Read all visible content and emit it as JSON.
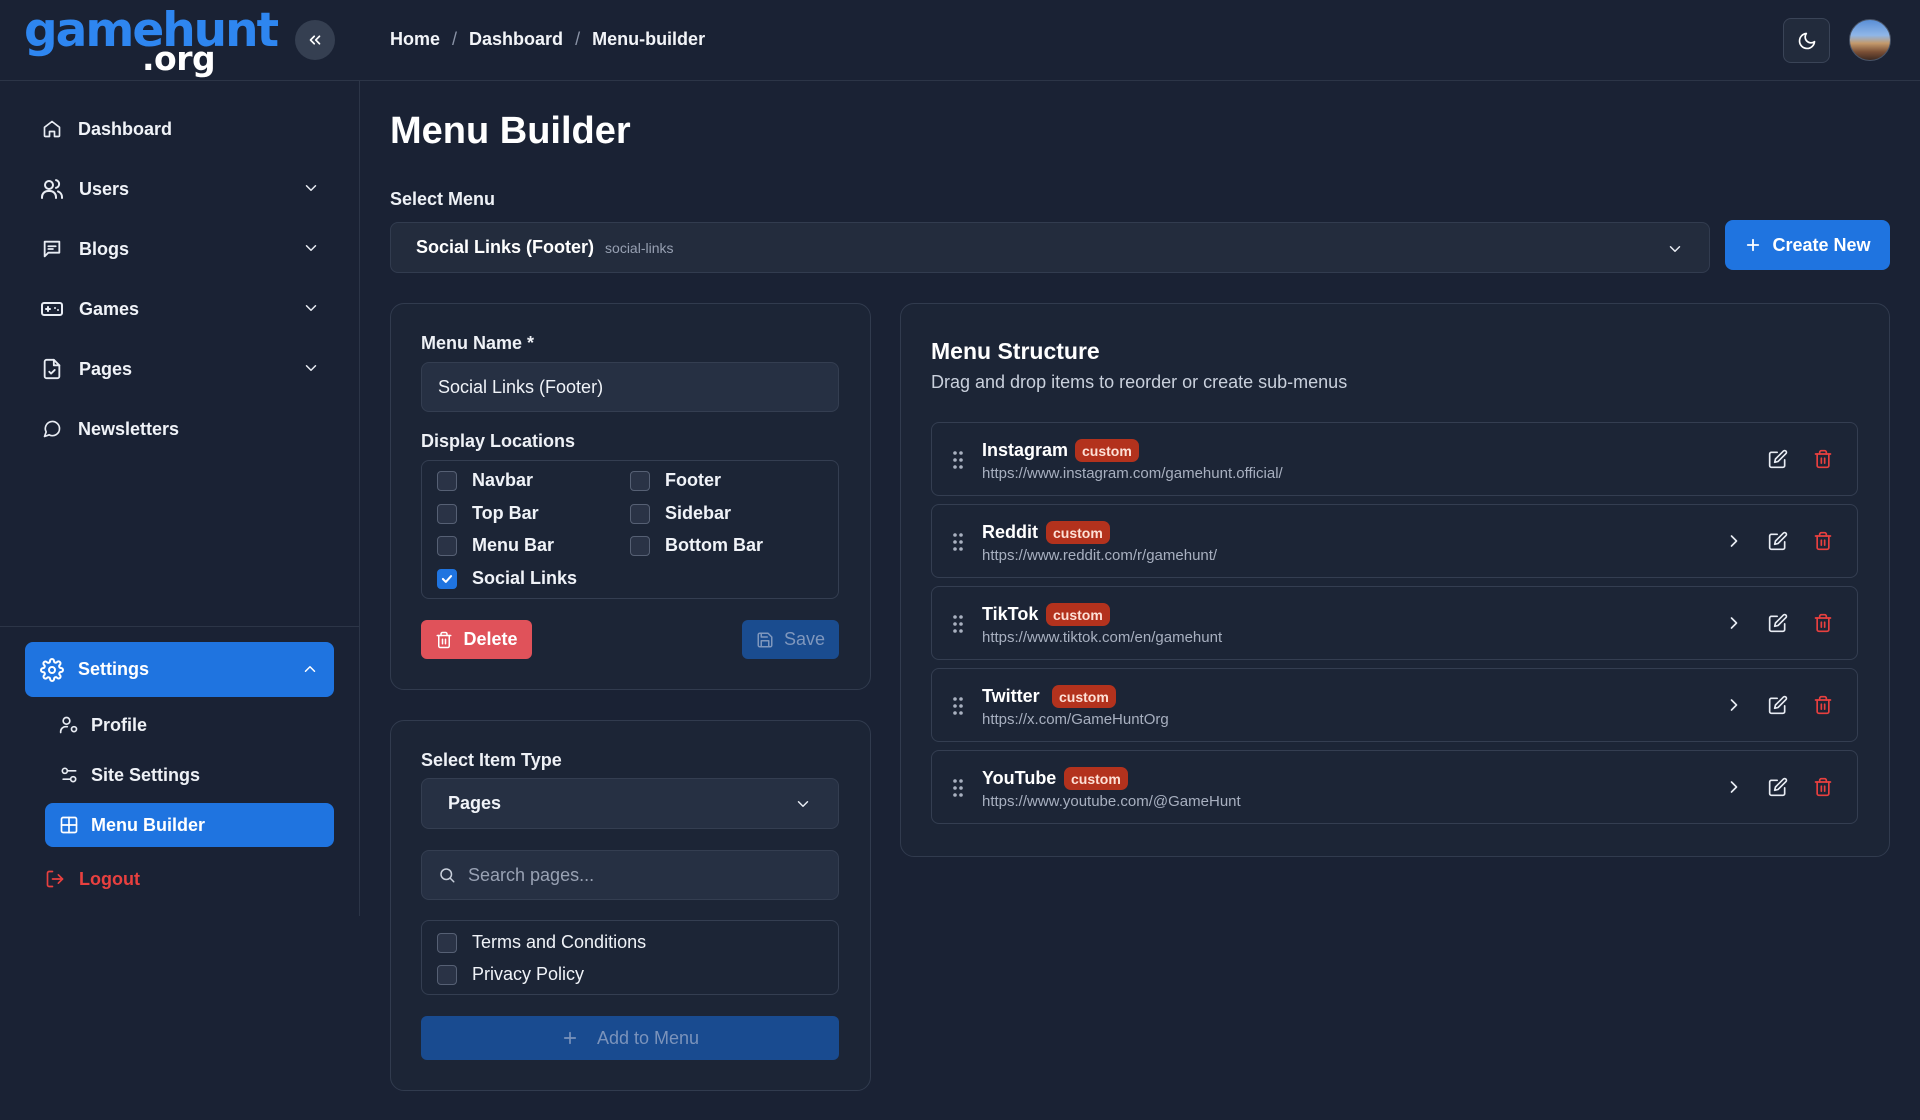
{
  "logo": {
    "line1": "gamehunt",
    "line2": ".org"
  },
  "breadcrumb": {
    "items": [
      "Home",
      "Dashboard",
      "Menu-builder"
    ],
    "separator": "/"
  },
  "sidebar": {
    "items": [
      {
        "label": "Dashboard",
        "icon": "home-icon"
      },
      {
        "label": "Users",
        "icon": "users-icon",
        "expandable": true
      },
      {
        "label": "Blogs",
        "icon": "blog-icon",
        "expandable": true
      },
      {
        "label": "Games",
        "icon": "gamepad-icon",
        "expandable": true
      },
      {
        "label": "Pages",
        "icon": "file-icon",
        "expandable": true
      },
      {
        "label": "Newsletters",
        "icon": "message-icon"
      }
    ],
    "settings": {
      "label": "Settings",
      "expanded": true,
      "children": [
        {
          "label": "Profile",
          "icon": "user-cog-icon"
        },
        {
          "label": "Site Settings",
          "icon": "sliders-icon"
        },
        {
          "label": "Menu Builder",
          "icon": "layout-grid-icon",
          "active": true
        }
      ]
    },
    "logout": "Logout"
  },
  "page": {
    "title": "Menu Builder"
  },
  "select_menu": {
    "label": "Select Menu",
    "value": "Social Links (Footer)",
    "slug": "social-links",
    "create_new": "Create New"
  },
  "menu_form": {
    "name_label": "Menu Name *",
    "name_value": "Social Links (Footer)",
    "locations_label": "Display Locations",
    "locations": [
      {
        "label": "Navbar",
        "checked": false
      },
      {
        "label": "Footer",
        "checked": false
      },
      {
        "label": "Top Bar",
        "checked": false
      },
      {
        "label": "Sidebar",
        "checked": false
      },
      {
        "label": "Menu Bar",
        "checked": false
      },
      {
        "label": "Bottom Bar",
        "checked": false
      },
      {
        "label": "Social Links",
        "checked": true
      }
    ],
    "delete_label": "Delete",
    "save_label": "Save"
  },
  "item_type": {
    "label": "Select Item Type",
    "value": "Pages",
    "search_placeholder": "Search pages...",
    "pages": [
      {
        "label": "Terms and Conditions",
        "checked": false
      },
      {
        "label": "Privacy Policy",
        "checked": false
      }
    ],
    "add_label": "Add to Menu"
  },
  "structure": {
    "title": "Menu Structure",
    "subtitle": "Drag and drop items to reorder or create sub-menus",
    "items": [
      {
        "name": "Instagram",
        "badge": "custom",
        "url": "https://www.instagram.com/gamehunt.official/",
        "has_children_toggle": false
      },
      {
        "name": "Reddit",
        "badge": "custom",
        "url": "https://www.reddit.com/r/gamehunt/",
        "has_children_toggle": true
      },
      {
        "name": "TikTok",
        "badge": "custom",
        "url": "https://www.tiktok.com/en/gamehunt",
        "has_children_toggle": true
      },
      {
        "name": "Twitter",
        "badge": "custom",
        "url": "https://x.com/GameHuntOrg",
        "has_children_toggle": true
      },
      {
        "name": "YouTube",
        "badge": "custom",
        "url": "https://www.youtube.com/@GameHunt",
        "has_children_toggle": true
      }
    ]
  },
  "colors": {
    "background": "#1a2234",
    "primary": "#1f74e0",
    "danger": "#e0525a",
    "badge": "#b3321d",
    "logout": "#e8403f"
  }
}
